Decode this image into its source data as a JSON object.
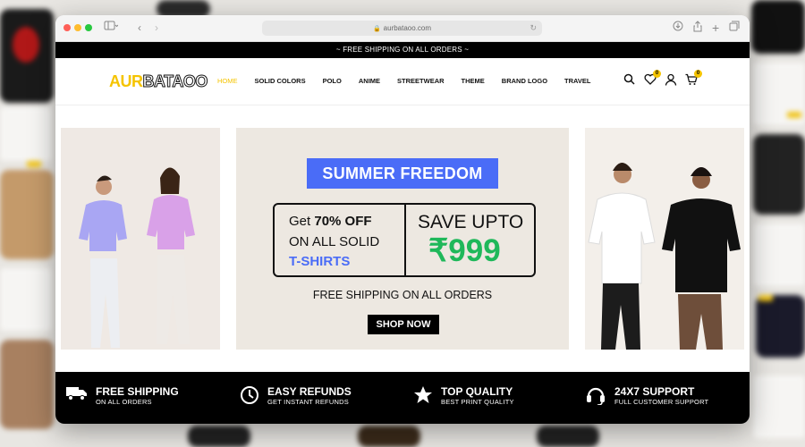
{
  "browser": {
    "url": "aurbataoo.com"
  },
  "announcement": "~ FREE SHIPPING ON ALL ORDERS ~",
  "header": {
    "logo_part1": "AUR",
    "logo_part2": "BATAOO",
    "menu": [
      {
        "label": "HOME",
        "active": true
      },
      {
        "label": "SOLID COLORS",
        "active": false
      },
      {
        "label": "POLO",
        "active": false
      },
      {
        "label": "ANIME",
        "active": false
      },
      {
        "label": "STREETWEAR",
        "active": false
      },
      {
        "label": "THEME",
        "active": false
      },
      {
        "label": "BRAND LOGO",
        "active": false
      },
      {
        "label": "TRAVEL",
        "active": false
      }
    ],
    "wishlist_count": "0",
    "cart_count": "0"
  },
  "hero": {
    "banner_title": "SUMMER FREEDOM",
    "offer_get": "Get ",
    "offer_percent": "70% OFF",
    "offer_on_all": "ON ALL SOLID",
    "offer_product": "T-SHIRTS",
    "save_upto": "SAVE UPTO",
    "price": "₹999",
    "shipping_text": "FREE SHIPPING ON ALL ORDERS",
    "cta": "SHOP NOW"
  },
  "features": [
    {
      "title": "FREE SHIPPING",
      "subtitle": "ON ALL ORDERS",
      "icon": "truck-icon"
    },
    {
      "title": "EASY REFUNDS",
      "subtitle": "GET INSTANT REFUNDS",
      "icon": "clock-icon"
    },
    {
      "title": "TOP QUALITY",
      "subtitle": "BEST PRINT QUALITY",
      "icon": "star-icon"
    },
    {
      "title": "24X7 SUPPORT",
      "subtitle": "FULL CUSTOMER SUPPORT",
      "icon": "headset-icon"
    }
  ],
  "colors": {
    "accent_yellow": "#f5c400",
    "banner_blue": "#4a6cf7",
    "price_green": "#1fb85a"
  }
}
